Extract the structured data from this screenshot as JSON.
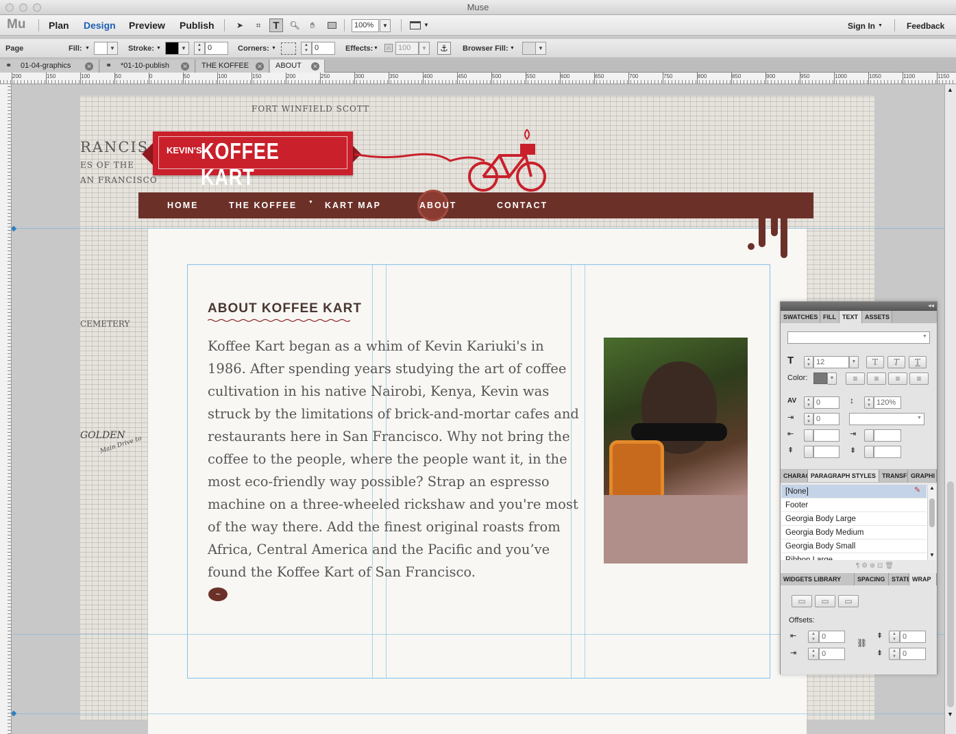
{
  "window": {
    "title": "Muse"
  },
  "app": {
    "logo": "Mu"
  },
  "menubar": {
    "tabs": [
      "Plan",
      "Design",
      "Preview",
      "Publish"
    ],
    "active_tab": "Design",
    "zoom": "100%",
    "sign_in": "Sign In",
    "feedback": "Feedback"
  },
  "propbar": {
    "page": "Page",
    "fill": "Fill:",
    "stroke": "Stroke:",
    "stroke_value": "0",
    "corners": "Corners:",
    "corners_value": "0",
    "effects": "Effects:",
    "effects_value": "100",
    "browser_fill": "Browser Fill:"
  },
  "doc_tabs": [
    {
      "label": "01-04-graphics"
    },
    {
      "label": "*01-10-publish"
    },
    {
      "label": "THE KOFFEE"
    },
    {
      "label": "ABOUT"
    }
  ],
  "ruler": {
    "h_ticks": [
      "200",
      "150",
      "100",
      "50",
      "0",
      "50",
      "100",
      "150",
      "200",
      "250",
      "300",
      "350",
      "400",
      "450",
      "500",
      "550",
      "600",
      "650",
      "700",
      "750",
      "800",
      "850",
      "900",
      "950",
      "1000",
      "1050",
      "1100",
      "1150"
    ]
  },
  "site": {
    "logo_small": "KEVIN'S",
    "logo_big": "KOFFEE KART",
    "map_labels": [
      "FORT WINFIELD SCOTT",
      "RANCIS",
      "ES OF THE",
      "AN FRANCISCO",
      "CEMETERY",
      "GOLDEN",
      "Main Drive to"
    ],
    "nav": [
      "HOME",
      "THE KOFFEE",
      "KART MAP",
      "ABOUT",
      "CONTACT"
    ],
    "about_heading": "ABOUT KOFFEE KART",
    "about_body": "Koffee Kart began as a whim of Kevin Kariuki's in 1986. After spending years studying the art of coffee cultivation in his native Nairobi, Kenya, Kevin was struck by the limitations of brick-and-mortar cafes and restaurants here in San Francisco. Why not bring the coffee to the people, where the people want it, in the most eco-friendly way possible? Strap an espresso machine on a three-wheeled rickshaw and you're most of the way there. Add the finest original roasts from Africa, Central America and the Pacific and you’ve found the Koffee Kart of San Francisco."
  },
  "panel": {
    "top_tabs": [
      "SWATCHES",
      "FILL",
      "TEXT",
      "ASSETS"
    ],
    "active_top": "TEXT",
    "font_size": "12",
    "color_label": "Color:",
    "tracking": "0",
    "leading": "120%",
    "indent": "0",
    "mid_tabs": [
      "CHARAC",
      "PARAGRAPH STYLES",
      "TRANSF",
      "GRAPHI"
    ],
    "active_mid": "PARAGRAPH STYLES",
    "styles": [
      "[None]",
      "Footer",
      "Georgia Body Large",
      "Georgia Body Medium",
      "Georgia Body Small",
      "Ribbon Large"
    ],
    "bottom_tabs": [
      "WIDGETS LIBRARY",
      "SPACING",
      "STATES",
      "WRAP"
    ],
    "active_bottom": "WRAP",
    "offsets_label": "Offsets:",
    "offsets": [
      "0",
      "0",
      "0",
      "0"
    ]
  },
  "colors": {
    "brand_red": "#c9202b",
    "nav_brown": "#6b3129",
    "accent_blue": "#1d5fb3"
  }
}
